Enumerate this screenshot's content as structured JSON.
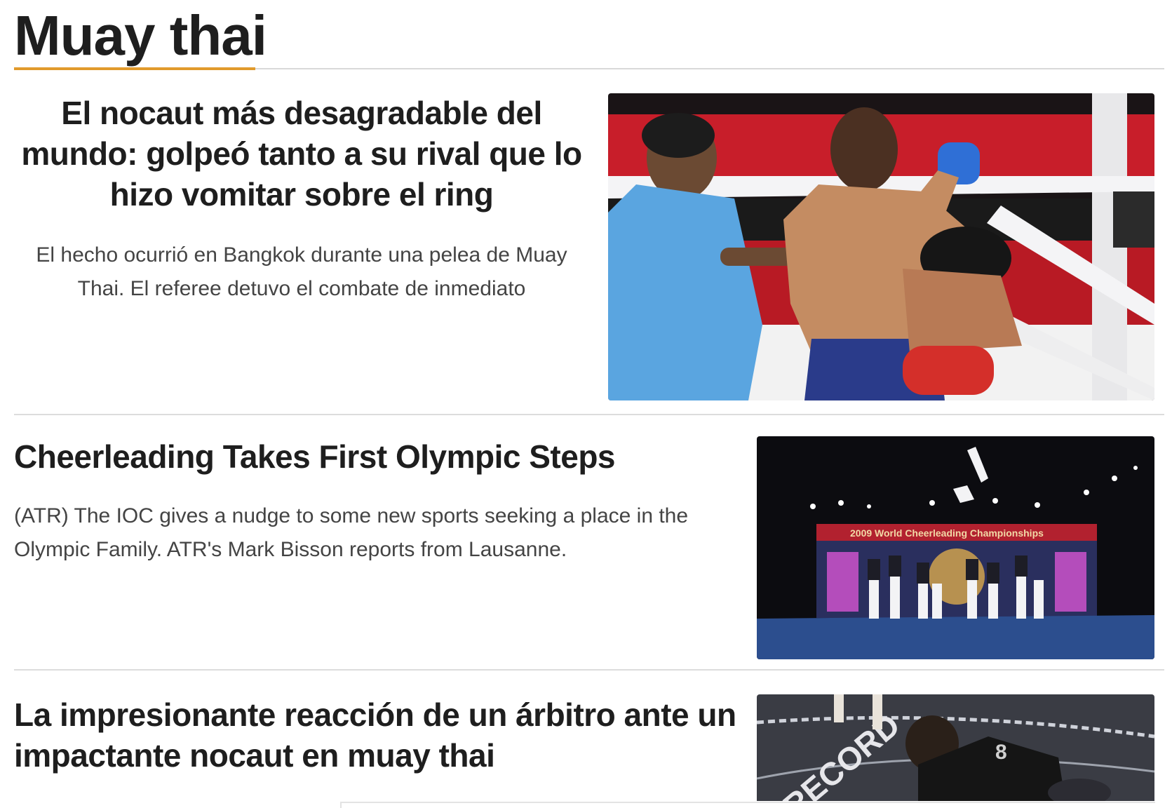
{
  "section": {
    "title": "Muay thai",
    "accent_color": "#e19a2c"
  },
  "articles": [
    {
      "headline": "El nocaut más desagradable del mundo: golpeó tanto a su rival que lo hizo vomitar sobre el ring",
      "summary": "El hecho ocurrió en Bangkok durante una pelea de Muay Thai. El referee detuvo el combate de inmediato",
      "image": "muay-thai-knockout-photo"
    },
    {
      "headline": "Cheerleading Takes First Olympic Steps",
      "summary": "(ATR) The IOC gives a nudge to some new sports seeking a place in the Olympic Family. ATR's Mark Bisson reports from Lausanne.",
      "image": "cheerleading-championship-photo",
      "image_banner_text": "2009 World Cheerleading Championships"
    },
    {
      "headline": "La impresionante reacción de un árbitro ante un impactante nocaut en muay thai",
      "summary": "",
      "image": "referee-reaction-photo"
    }
  ]
}
